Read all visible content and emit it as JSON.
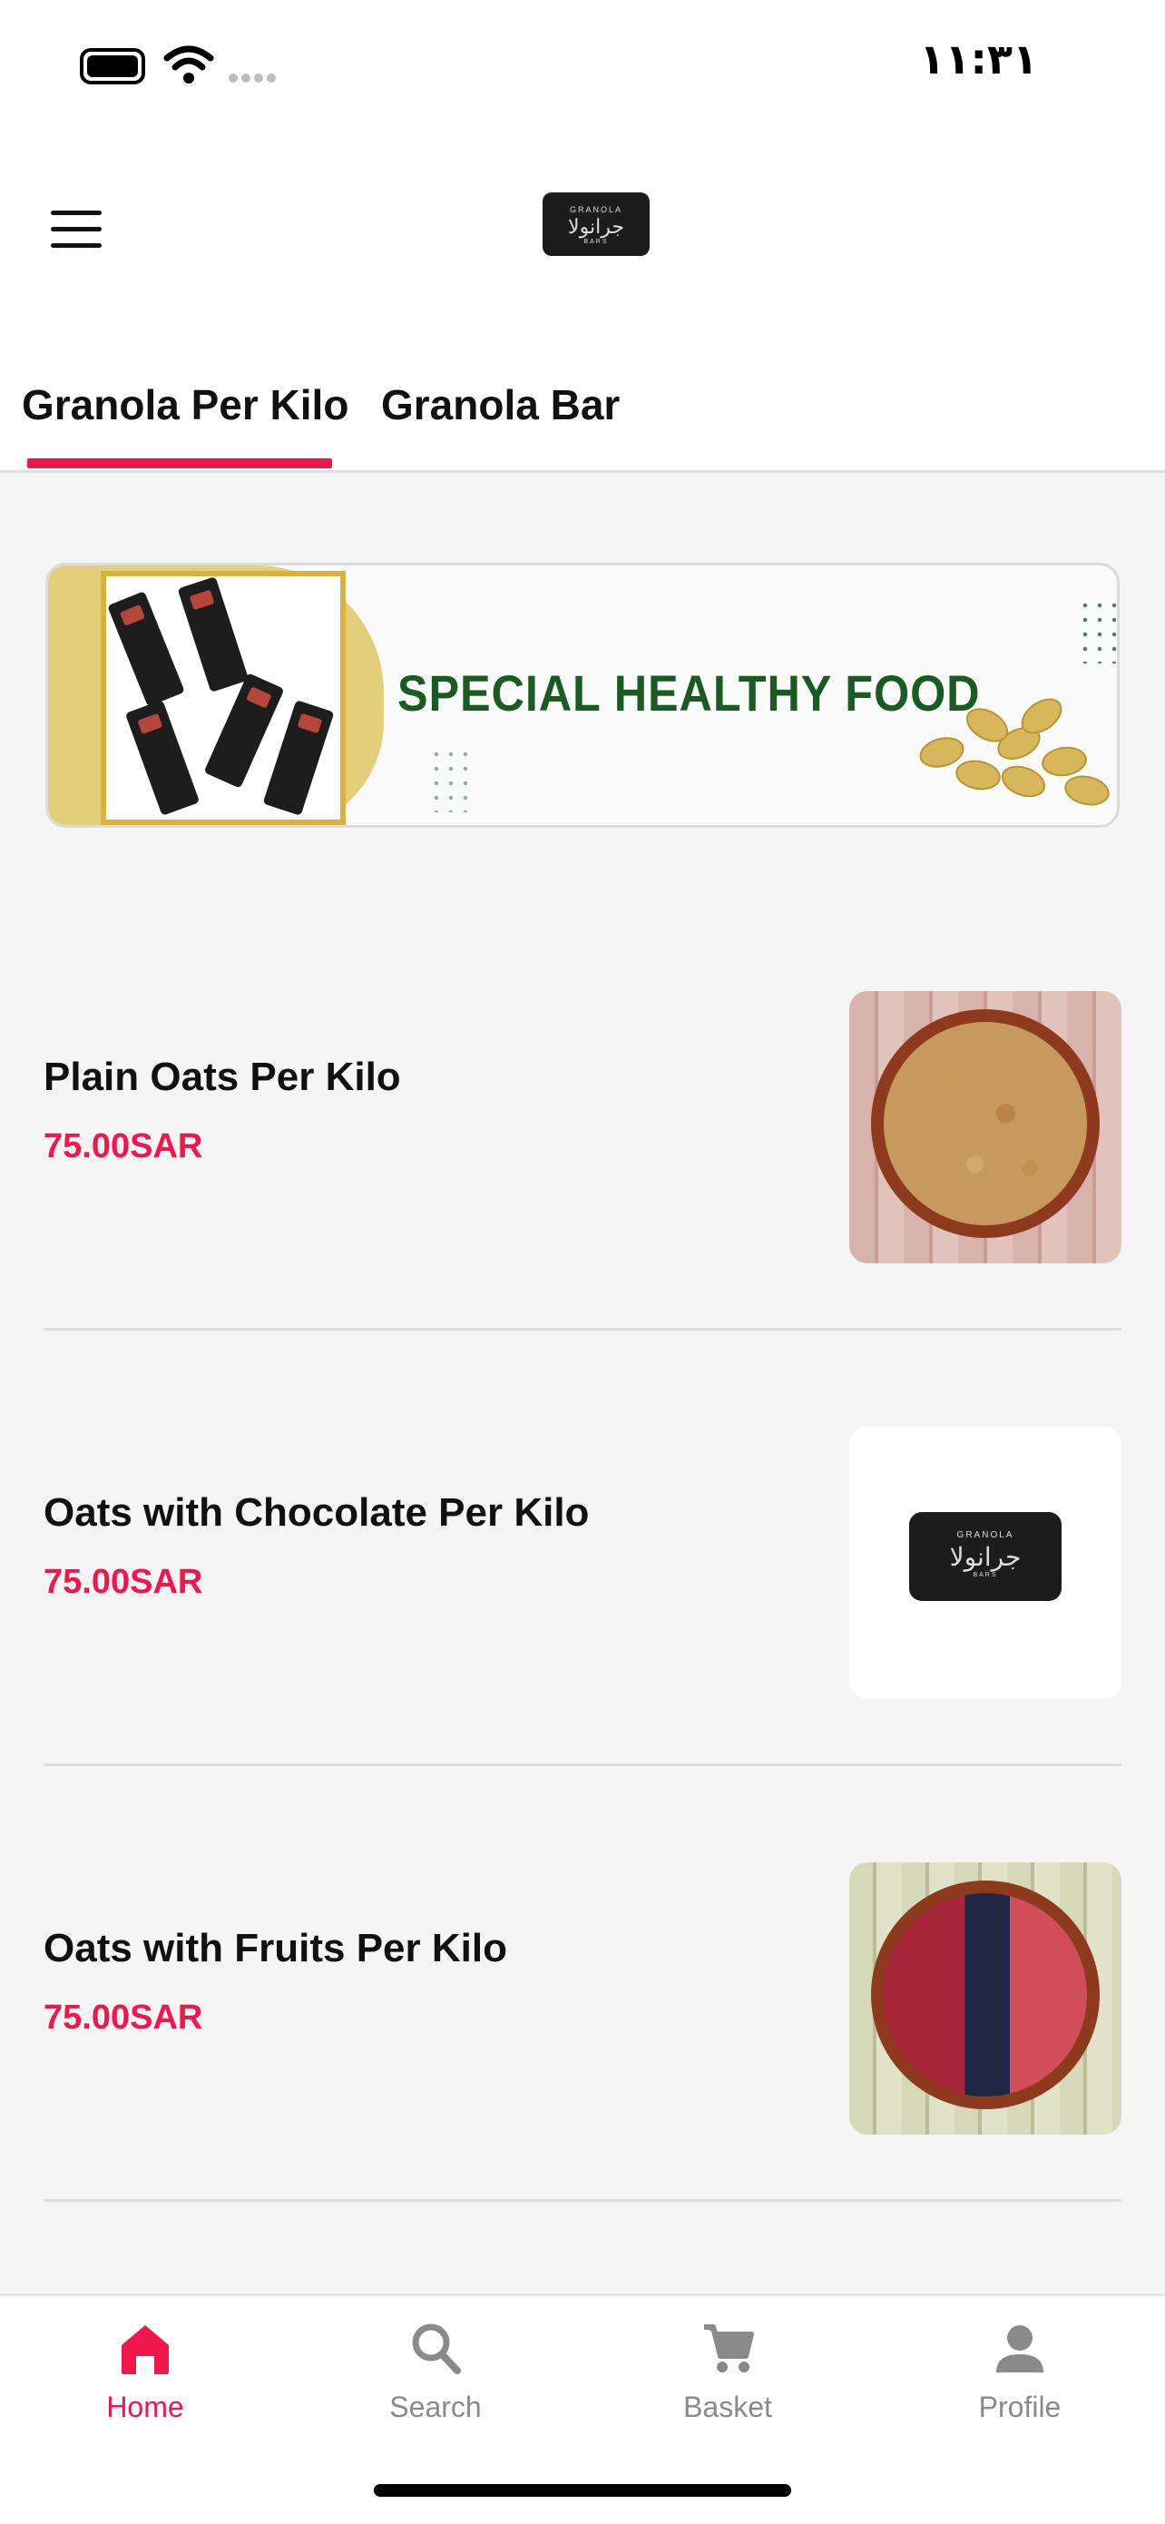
{
  "status_bar": {
    "time": "١١:٣١"
  },
  "header": {
    "menu_icon": "hamburger-menu-icon",
    "logo": {
      "top_text": "GRANOLA",
      "main_text": "جرانولا",
      "bottom_text": "BARS"
    }
  },
  "tabs": [
    {
      "label": "Granola Per Kilo",
      "selected": true
    },
    {
      "label": "Granola Bar",
      "selected": false
    }
  ],
  "banner": {
    "title": "SPECIAL HEALTHY FOOD"
  },
  "products": [
    {
      "name": "Plain Oats Per Kilo",
      "price": "75.00SAR",
      "image": "oats-bowl"
    },
    {
      "name": "Oats with Chocolate Per Kilo",
      "price": "75.00SAR",
      "image": "brand-logo"
    },
    {
      "name": "Oats with Fruits Per Kilo",
      "price": "75.00SAR",
      "image": "berries-bowl"
    }
  ],
  "bottom_nav": [
    {
      "label": "Home",
      "icon": "home-icon",
      "active": true
    },
    {
      "label": "Search",
      "icon": "search-icon",
      "active": false
    },
    {
      "label": "Basket",
      "icon": "cart-icon",
      "active": false
    },
    {
      "label": "Profile",
      "icon": "person-icon",
      "active": false
    }
  ],
  "colors": {
    "accent": "#f0184b",
    "banner_green": "#1b5a23",
    "inactive": "#8a8a8a"
  }
}
